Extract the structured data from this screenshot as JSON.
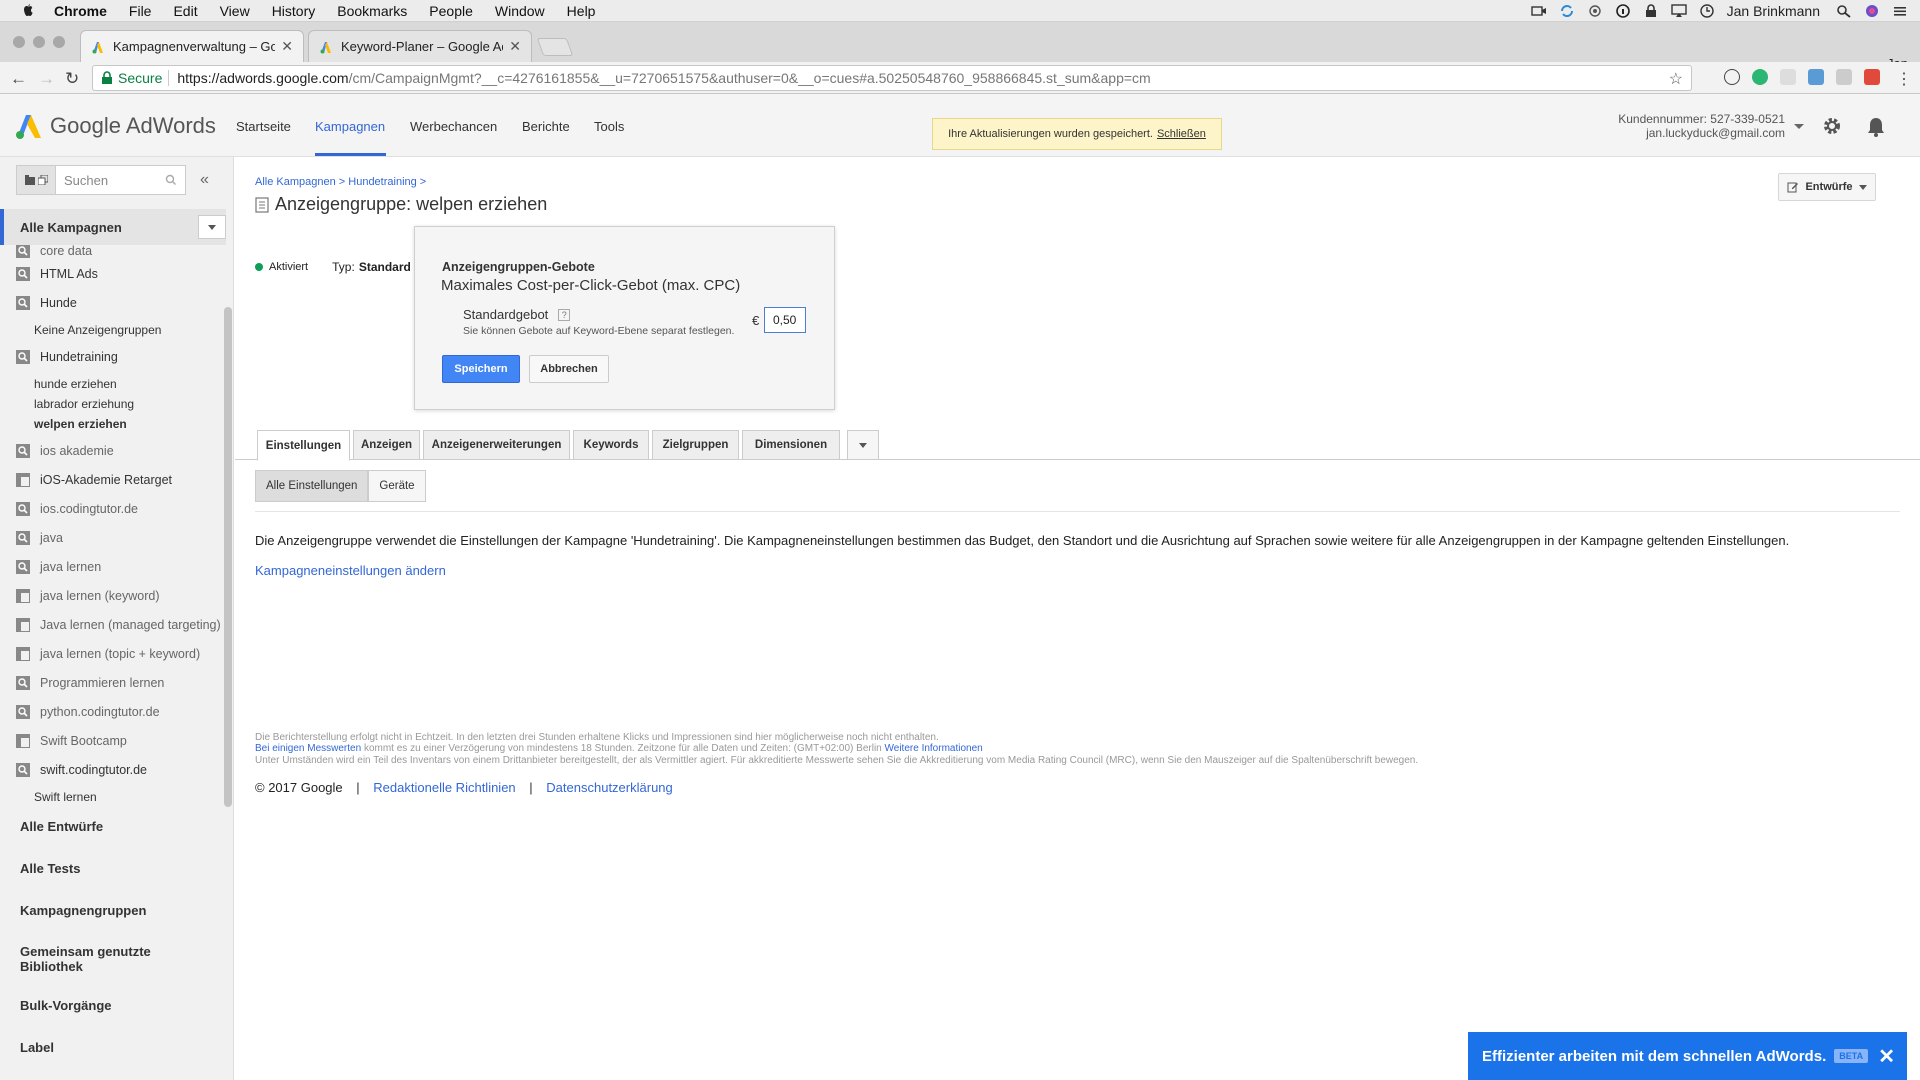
{
  "menubar": {
    "app": "Chrome",
    "items": [
      "File",
      "Edit",
      "View",
      "History",
      "Bookmarks",
      "People",
      "Window",
      "Help"
    ],
    "user": "Jan Brinkmann"
  },
  "browser": {
    "tabs": [
      {
        "title": "Kampagnenverwaltung – Goog",
        "active": true
      },
      {
        "title": "Keyword-Planer – Google AdW",
        "active": false
      }
    ],
    "profile": "Jan",
    "secure_label": "Secure",
    "url_host": "https://adwords.google.com",
    "url_rest": "/cm/CampaignMgmt?__c=4276161855&__u=7270651575&authuser=0&__o=cues#a.50250548760_958866845.st_sum&app=cm"
  },
  "adwords": {
    "logo_text": "Google AdWords",
    "nav": [
      "Startseite",
      "Kampagnen",
      "Werbechancen",
      "Berichte",
      "Tools"
    ],
    "notice_text": "Ihre Aktualisierungen wurden gespeichert.",
    "notice_link": "Schließen",
    "customer_number": "Kundennummer: 527-339-0521",
    "customer_email": "jan.luckyduck@gmail.com",
    "accent_color": "#3367d6"
  },
  "sidebar": {
    "search_placeholder": "Suchen",
    "all_campaigns": "Alle Kampagnen",
    "items": [
      {
        "label": "core data",
        "icon": "search-icon",
        "kind": "campaign"
      },
      {
        "label": "HTML Ads",
        "icon": "search-icon",
        "kind": "campaign"
      },
      {
        "label": "Hunde",
        "icon": "search-icon",
        "kind": "campaign"
      },
      {
        "label": "Keine Anzeigengruppen",
        "kind": "adgroup"
      },
      {
        "label": "Hundetraining",
        "icon": "search-icon",
        "kind": "campaign"
      },
      {
        "label": "hunde erziehen",
        "kind": "adgroup"
      },
      {
        "label": "labrador erziehung",
        "kind": "adgroup"
      },
      {
        "label": "welpen erziehen",
        "kind": "adgroup",
        "selected": true
      },
      {
        "label": "ios akademie",
        "icon": "search-icon",
        "kind": "campaign"
      },
      {
        "label": "iOS-Akademie Retarget",
        "icon": "display-icon",
        "kind": "campaign"
      },
      {
        "label": "ios.codingtutor.de",
        "icon": "search-icon",
        "kind": "campaign"
      },
      {
        "label": "java",
        "icon": "search-icon",
        "kind": "campaign"
      },
      {
        "label": "java lernen",
        "icon": "search-icon",
        "kind": "campaign"
      },
      {
        "label": "java lernen (keyword)",
        "icon": "display-icon",
        "kind": "campaign"
      },
      {
        "label": "Java lernen (managed targeting)",
        "icon": "display-icon",
        "kind": "campaign"
      },
      {
        "label": "java lernen (topic + keyword)",
        "icon": "display-icon",
        "kind": "campaign"
      },
      {
        "label": "Programmieren lernen",
        "icon": "search-icon",
        "kind": "campaign"
      },
      {
        "label": "python.codingtutor.de",
        "icon": "search-icon",
        "kind": "campaign"
      },
      {
        "label": "Swift Bootcamp",
        "icon": "display-icon",
        "kind": "campaign"
      },
      {
        "label": "swift.codingtutor.de",
        "icon": "search-icon",
        "kind": "campaign"
      },
      {
        "label": "Swift lernen",
        "kind": "adgroup"
      }
    ],
    "sections": [
      "Alle Entwürfe",
      "Alle Tests",
      "Kampagnengruppen",
      "Gemeinsam genutzte Bibliothek",
      "Bulk-Vorgänge",
      "Label"
    ]
  },
  "main": {
    "breadcrumb": "Alle Kampagnen > Hundetraining >",
    "title_prefix": "Anzeigengruppe:",
    "title_name": "welpen erziehen",
    "drafts_button": "Entwürfe",
    "status": "Aktiviert",
    "type_label": "Typ:",
    "type_value": "Standard",
    "bid_popup": {
      "heading": "Anzeigengruppen-Gebote",
      "subheading": "Maximales Cost-per-Click-Gebot (max. CPC)",
      "default_bid_label": "Standardgebot",
      "help": "?",
      "hint": "Sie können Gebote auf Keyword-Ebene separat festlegen.",
      "currency": "€",
      "bid_value": "0,50",
      "save_label": "Speichern",
      "cancel_label": "Abbrechen"
    },
    "tabs": [
      "Einstellungen",
      "Anzeigen",
      "Anzeigenerweiterungen",
      "Keywords",
      "Zielgruppen",
      "Dimensionen"
    ],
    "subtabs": [
      "Alle Einstellungen",
      "Geräte"
    ],
    "settings_text": "Die Anzeigengruppe verwendet die Einstellungen der Kampagne 'Hundetraining'. Die Kampagneneinstellungen bestimmen das Budget, den Standort und die Ausrichtung auf Sprachen sowie weitere für alle Anzeigengruppen in der Kampagne geltenden Einstellungen.",
    "change_link": "Kampagneneinstellungen ändern"
  },
  "footer": {
    "note1": "Die Berichterstellung erfolgt nicht in Echtzeit. In den letzten drei Stunden erhaltene Klicks und Impressionen sind hier möglicherweise noch nicht enthalten.",
    "note2_link": "Bei einigen Messwerten",
    "note2_text": " kommt es zu einer Verzögerung von mindestens 18 Stunden. Zeitzone für alle Daten und Zeiten: (GMT+02:00) Berlin ",
    "note2_link2": "Weitere Informationen",
    "note3": "Unter Umständen wird ein Teil des Inventars von einem Drittanbieter bereitgestellt, der als Vermittler agiert. Für akkreditierte Messwerte sehen Sie die Akkreditierung vom Media Rating Council (MRC), wenn Sie den Mauszeiger auf die Spaltenüberschrift bewegen.",
    "copyright": "© 2017 Google",
    "link1": "Redaktionelle Richtlinien",
    "link2": "Datenschutzerklärung",
    "separator": "|"
  },
  "promo": {
    "text": "Effizienter arbeiten mit dem schnellen AdWords.",
    "badge": "BETA"
  }
}
